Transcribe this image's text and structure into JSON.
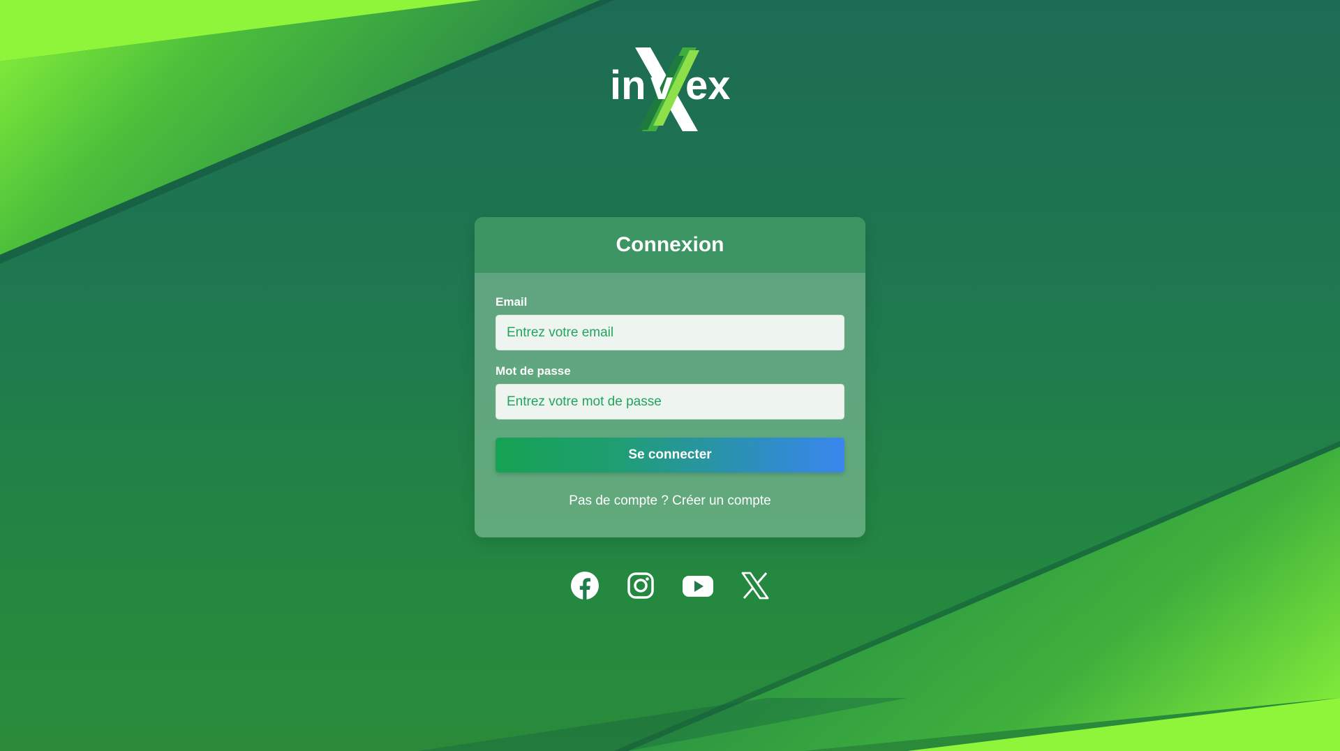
{
  "brand": {
    "logo_text": "invex"
  },
  "login_card": {
    "title": "Connexion",
    "email": {
      "label": "Email",
      "placeholder": "Entrez votre email",
      "value": ""
    },
    "password": {
      "label": "Mot de passe",
      "placeholder": "Entrez votre mot de passe",
      "value": ""
    },
    "submit_label": "Se connecter",
    "signup": {
      "prefix": "Pas de compte ?",
      "link_label": "Créer un compte"
    }
  },
  "socials": [
    {
      "name": "facebook",
      "icon": "facebook-icon"
    },
    {
      "name": "instagram",
      "icon": "instagram-icon"
    },
    {
      "name": "youtube",
      "icon": "youtube-icon"
    },
    {
      "name": "x",
      "icon": "x-icon"
    }
  ],
  "colors": {
    "brand_green": "#3c9563",
    "accent_light_green": "#7be82f",
    "button_gradient_start": "#16a253",
    "button_gradient_end": "#3a86ef",
    "placeholder_green": "#22a45a"
  }
}
